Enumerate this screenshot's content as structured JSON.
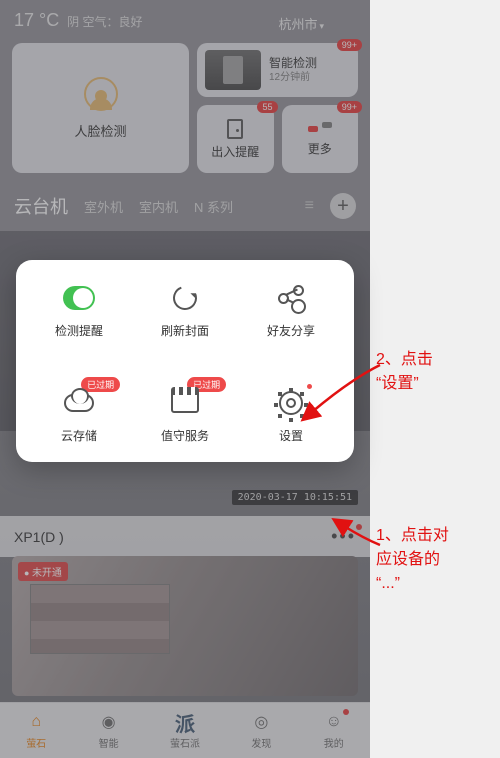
{
  "header": {
    "temp": "17 °C",
    "weather": "阴 空气：良好",
    "city": "杭州市"
  },
  "topcards": {
    "face_detect": "人脸检测",
    "smart_detect": {
      "title": "智能检测",
      "time": "12分钟前",
      "badge": "99+"
    },
    "inout": {
      "label": "出入提醒",
      "badge": "55"
    },
    "more": {
      "label": "更多",
      "badge": "99+"
    }
  },
  "categories": {
    "items": [
      "云台机",
      "室外机",
      "室内机",
      "N 系列"
    ]
  },
  "popup": {
    "items": [
      {
        "label": "检测提醒"
      },
      {
        "label": "刷新封面"
      },
      {
        "label": "好友分享"
      },
      {
        "label": "云存储",
        "pill": "已过期"
      },
      {
        "label": "值守服务",
        "pill": "已过期"
      },
      {
        "label": "设置",
        "reddot": true
      }
    ]
  },
  "timestamp": "2020-03-17 10:15:51",
  "device": {
    "name": "XP1(D                    )",
    "dots": "•••"
  },
  "camera_preview": {
    "tag": "未开通"
  },
  "nav": {
    "items": [
      "萤石",
      "智能",
      "萤石派",
      "发现",
      "我的"
    ],
    "center_glyph": "派"
  },
  "annotations": {
    "a1": "2、点击<br>“设置”",
    "a2": "1、点击对<br>应设备的<br>“...”"
  }
}
